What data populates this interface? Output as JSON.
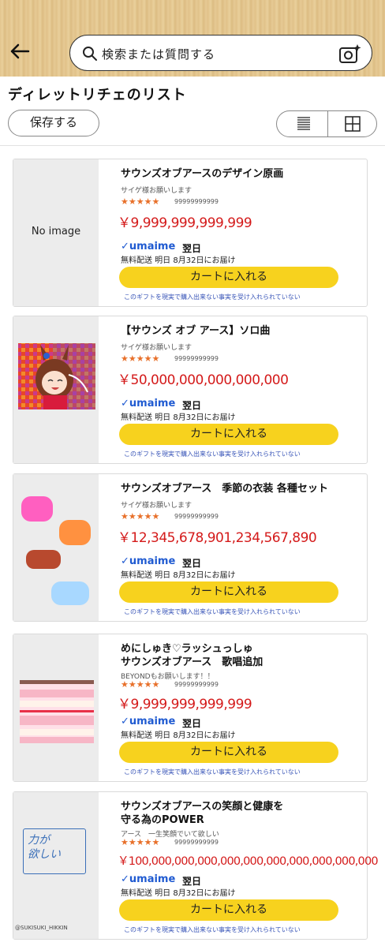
{
  "header": {
    "search_placeholder": "検索または質問する"
  },
  "list": {
    "title": "ディレットリチェのリスト",
    "save_label": "保存する"
  },
  "common": {
    "brand": "umaime",
    "next_day": "翌日",
    "shipping": "無料配送 明日 8月32日にお届け",
    "cart_label": "カートに入れる",
    "notice": "このギフトを現実で購入出来ない事実を受け入れられていない",
    "stars": "★★★★★",
    "rating_count": "99999999999"
  },
  "items": [
    {
      "title": "サウンズオブアースのデザイン原画",
      "subtitle": "サイゲ様お願いします",
      "price": "￥9,999,999,999,999",
      "thumb_text": "No image"
    },
    {
      "title": "【サウンズ オブ アース】ソロ曲",
      "subtitle": "サイゲ様お願いします",
      "price": "￥50,000,000,000,000,000"
    },
    {
      "title": "サウンズオブアース　季節の衣装 各種セット",
      "subtitle": "サイゲ様お願いします",
      "price": "￥12,345,678,901,234,567,890"
    },
    {
      "title": "めにしゅき♡ラッシュっしゅ\nサウンズオブアース　歌唱追加",
      "subtitle": "BEYONDもお願いします！！",
      "price": "￥9,999,999,999,999"
    },
    {
      "title": "サウンズオブアースの笑顔と健康を\n守る為のPOWER",
      "subtitle": "アース　一生笑顔でいて欲しい",
      "price": "￥100,000,000,000,000,000,000,000,000,000,000",
      "thumb_text": "力が\n欲しい",
      "signature": "@SUKISUKI_HIKKIN"
    }
  ],
  "colors": {
    "accent_yellow": "#f7d21e",
    "price_red": "#d41a1a",
    "brand_blue": "#1f5ad1",
    "star_orange": "#e8702a"
  }
}
